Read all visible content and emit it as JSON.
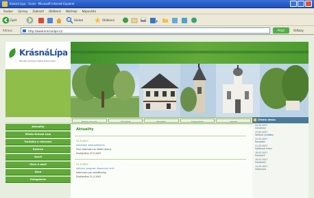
{
  "browser": {
    "title": "Krásná Lípa - Úvod - Microsoft Internet Explorer",
    "menu": [
      "Soubor",
      "Úpravy",
      "Zobrazit",
      "Oblíbené",
      "Nástroje",
      "Nápověda"
    ],
    "toolbar": {
      "back": "Zpět",
      "search": "Hledat",
      "favorites": "Oblíbené"
    },
    "address": {
      "label": "Adresa",
      "value": "http://www.krasnalipa.cz/",
      "go": "Přejít",
      "links": "Odkazy"
    }
  },
  "site": {
    "logo_name": "KrásnáLípa",
    "logo_sub": "Oficiální stránky města Krásná Lípa"
  },
  "nav_top": [
    "Servis pro vás",
    "Aktuálně",
    "Kontakty",
    "Fotogalerie",
    "Hledat"
  ],
  "left_nav": [
    "Aktuality",
    "Město Krásná Lípa",
    "Turistika a rekreace",
    "Kultura",
    "Sport",
    "Obce a okolí",
    "Akce",
    "Fotogalerie"
  ],
  "content": {
    "title": "Aktuality",
    "news": [
      {
        "date": "23.5.2007",
        "head": "Zasedání zastupitelstva",
        "text1": "Více informací na úřední desce.",
        "text2": "Zveřejněno 23.5.2007"
      },
      {
        "date": "21.5.2007",
        "head": "Kulturní program Kamenný vrch",
        "text1": "Informace pro návštěvníky.",
        "text2": "Zveřejněno 21.5.2007"
      }
    ]
  },
  "right_col": {
    "header": "Úřední deska",
    "items": [
      {
        "date": "24.05.2007",
        "title": "Oznámení"
      },
      {
        "date": "23.05.2007",
        "title": "Veřejná vyhláška"
      },
      {
        "date": "22.05.2007",
        "title": "Rozpočet"
      },
      {
        "date": "21.05.2007",
        "title": "Výběrové řízení"
      },
      {
        "date": "18.05.2007",
        "title": "Usnesení"
      },
      {
        "date": "16.05.2007",
        "title": "Oznámení"
      },
      {
        "date": "14.05.2007",
        "title": "Informace"
      }
    ]
  },
  "colors": {
    "brand_green": "#5faa38",
    "logo_blue": "#2a4f9a",
    "link_blue": "#3a7fc0"
  }
}
